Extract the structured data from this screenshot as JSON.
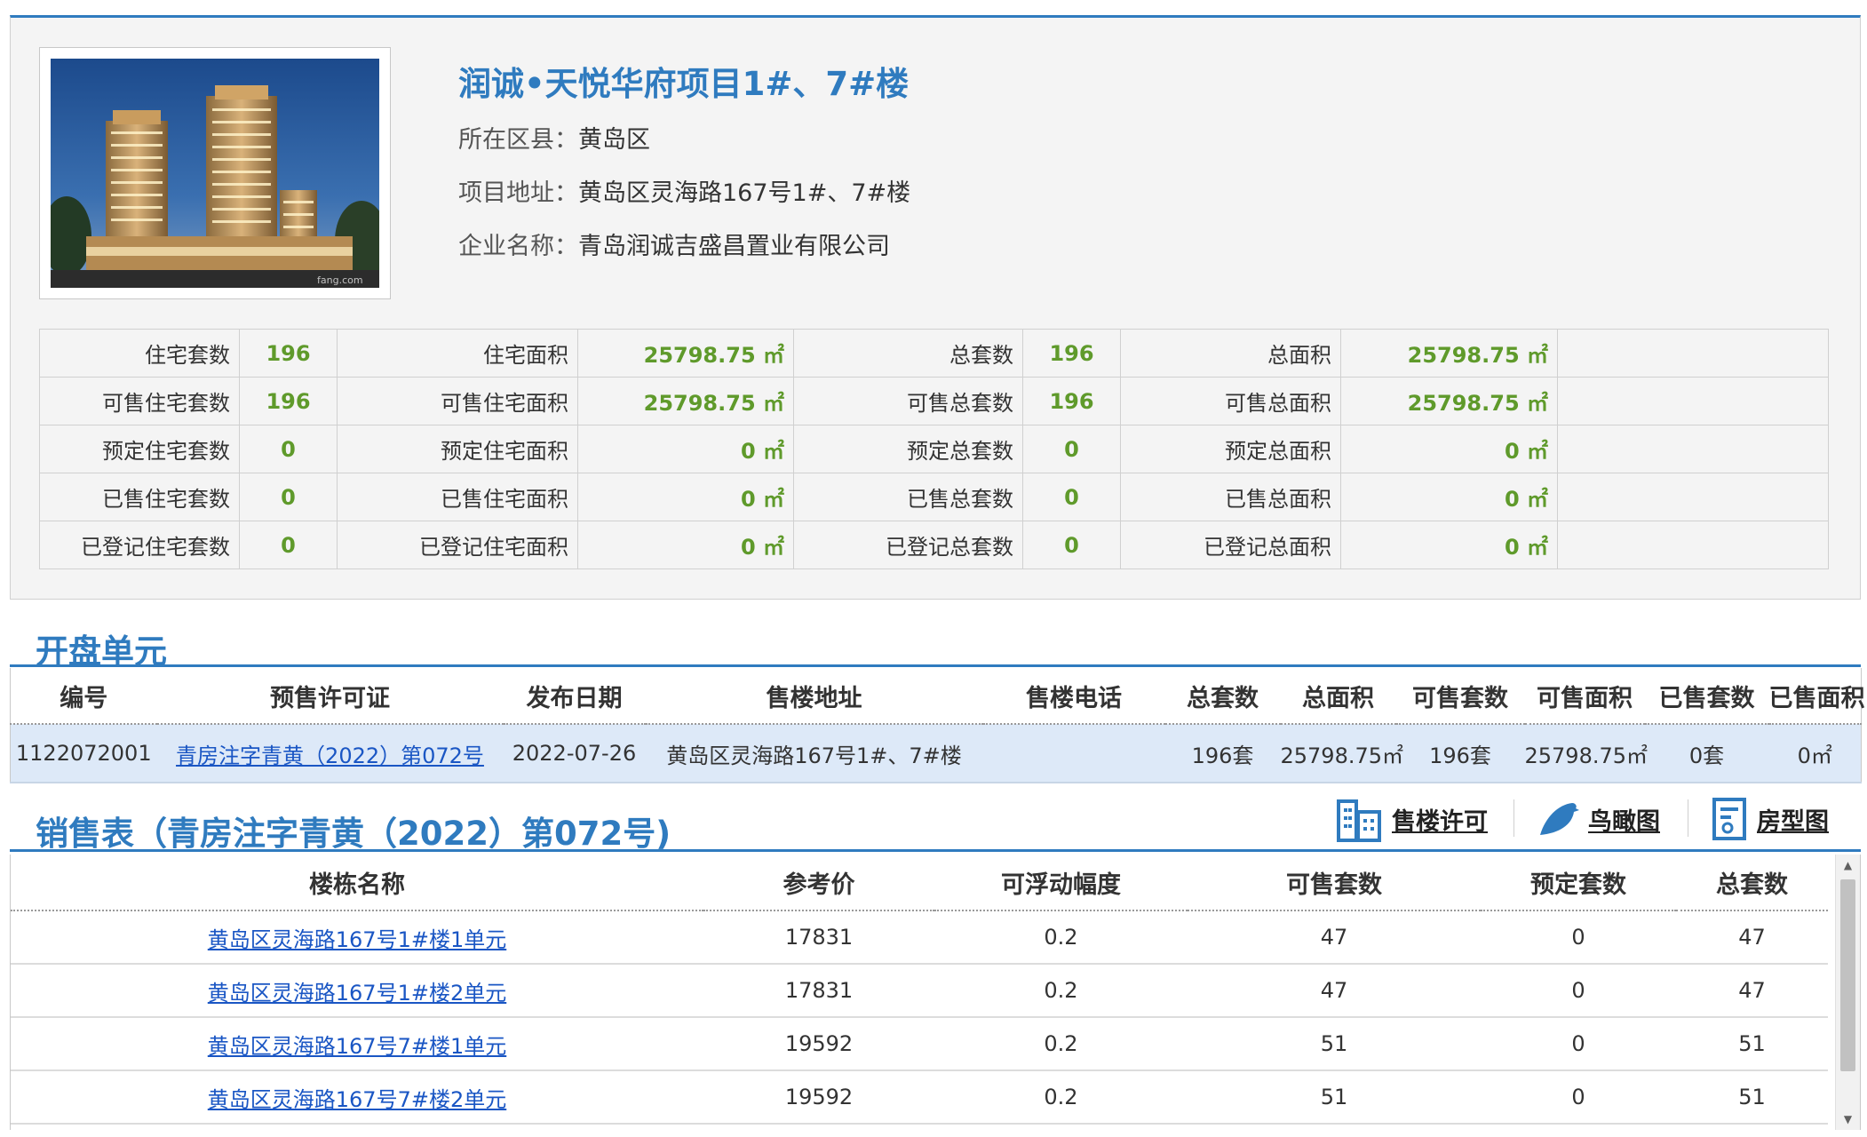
{
  "project": {
    "title": "润诚•天悦华府项目1#、7#楼",
    "district_label": "所在区县：",
    "district": "黄岛区",
    "address_label": "项目地址：",
    "address": "黄岛区灵海路167号1#、7#楼",
    "company_label": "企业名称：",
    "company": "青岛润诚吉盛昌置业有限公司",
    "photo_watermark": "fang.com",
    "photo_icon": "building-photo"
  },
  "stats": [
    [
      {
        "label": "住宅套数",
        "value": "196"
      },
      {
        "label": "住宅面积",
        "value": "25798.75 ㎡"
      },
      {
        "label": "总套数",
        "value": "196"
      },
      {
        "label": "总面积",
        "value": "25798.75 ㎡"
      }
    ],
    [
      {
        "label": "可售住宅套数",
        "value": "196"
      },
      {
        "label": "可售住宅面积",
        "value": "25798.75 ㎡"
      },
      {
        "label": "可售总套数",
        "value": "196"
      },
      {
        "label": "可售总面积",
        "value": "25798.75 ㎡"
      }
    ],
    [
      {
        "label": "预定住宅套数",
        "value": "0"
      },
      {
        "label": "预定住宅面积",
        "value": "0 ㎡"
      },
      {
        "label": "预定总套数",
        "value": "0"
      },
      {
        "label": "预定总面积",
        "value": "0 ㎡"
      }
    ],
    [
      {
        "label": "已售住宅套数",
        "value": "0"
      },
      {
        "label": "已售住宅面积",
        "value": "0 ㎡"
      },
      {
        "label": "已售总套数",
        "value": "0"
      },
      {
        "label": "已售总面积",
        "value": "0 ㎡"
      }
    ],
    [
      {
        "label": "已登记住宅套数",
        "value": "0"
      },
      {
        "label": "已登记住宅面积",
        "value": "0 ㎡"
      },
      {
        "label": "已登记总套数",
        "value": "0"
      },
      {
        "label": "已登记总面积",
        "value": "0 ㎡"
      }
    ]
  ],
  "open_units": {
    "title": "开盘单元",
    "headers": [
      "编号",
      "预售许可证",
      "发布日期",
      "售楼地址",
      "售楼电话",
      "总套数",
      "总面积",
      "可售套数",
      "可售面积",
      "已售套数",
      "已售面积"
    ],
    "rows": [
      {
        "id": "1122072001",
        "permit": "青房注字青黄（2022）第072号",
        "date": "2022-07-26",
        "address": "黄岛区灵海路167号1#、7#楼",
        "phone": "",
        "total_units": "196套",
        "total_area": "25798.75㎡",
        "avail_units": "196套",
        "avail_area": "25798.75㎡",
        "sold_units": "0套",
        "sold_area": "0㎡"
      }
    ]
  },
  "sales": {
    "title": "销售表（青房注字青黄（2022）第072号)",
    "tools": {
      "permit": {
        "label": "售楼许可",
        "icon": "building-icon"
      },
      "aerial": {
        "label": "鸟瞰图",
        "icon": "bird-icon"
      },
      "floorplan": {
        "label": "房型图",
        "icon": "document-icon"
      }
    },
    "headers": [
      "楼栋名称",
      "参考价",
      "可浮动幅度",
      "可售套数",
      "预定套数",
      "总套数"
    ],
    "rows": [
      {
        "name": "黄岛区灵海路167号1#楼1单元",
        "price": "17831",
        "float": "0.2",
        "avail": "47",
        "reserved": "0",
        "total": "47"
      },
      {
        "name": "黄岛区灵海路167号1#楼2单元",
        "price": "17831",
        "float": "0.2",
        "avail": "47",
        "reserved": "0",
        "total": "47"
      },
      {
        "name": "黄岛区灵海路167号7#楼1单元",
        "price": "19592",
        "float": "0.2",
        "avail": "51",
        "reserved": "0",
        "total": "51"
      },
      {
        "name": "黄岛区灵海路167号7#楼2单元",
        "price": "19592",
        "float": "0.2",
        "avail": "51",
        "reserved": "0",
        "total": "51"
      }
    ]
  },
  "colors": {
    "accent_blue": "#2f7bbf",
    "value_green": "#5f9a2b",
    "link_blue": "#1a56c4",
    "row_highlight": "#dde9f8"
  }
}
